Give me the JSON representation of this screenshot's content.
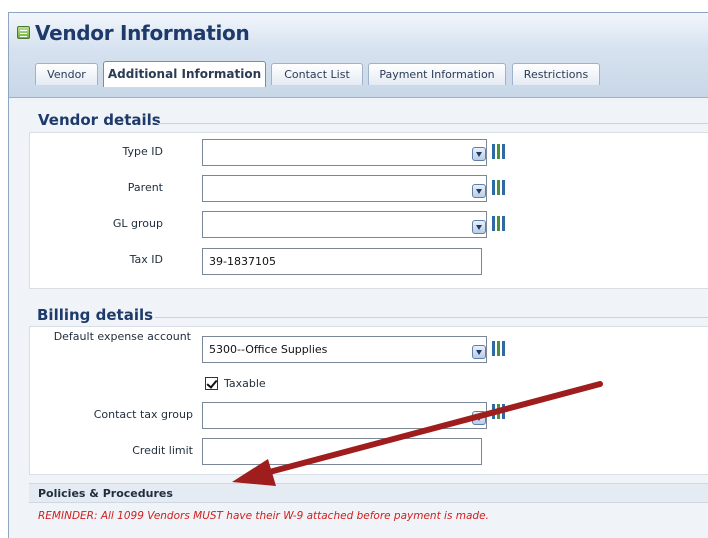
{
  "window": {
    "title": "Vendor Information"
  },
  "tabs": [
    {
      "label": "Vendor"
    },
    {
      "label": "Additional Information"
    },
    {
      "label": "Contact List"
    },
    {
      "label": "Payment Information"
    },
    {
      "label": "Restrictions"
    }
  ],
  "vendor_details": {
    "title": "Vendor details",
    "type_id": {
      "label": "Type ID",
      "value": ""
    },
    "parent": {
      "label": "Parent",
      "value": ""
    },
    "gl_group": {
      "label": "GL group",
      "value": ""
    },
    "tax_id": {
      "label": "Tax ID",
      "value": "39-1837105"
    }
  },
  "billing_details": {
    "title": "Billing details",
    "default_expense_account": {
      "label": "Default expense account",
      "value": "5300--Office Supplies"
    },
    "taxable": {
      "label": "Taxable",
      "checked": true
    },
    "contact_tax_group": {
      "label": "Contact tax group",
      "value": ""
    },
    "credit_limit": {
      "label": "Credit limit",
      "value": ""
    }
  },
  "policies": {
    "title": "Policies & Procedures",
    "reminder": "REMINDER: All 1099 Vendors MUST have their W-9 attached before payment is made."
  },
  "colors": {
    "title": "#1d3a6b",
    "reminder": "#d01e1e",
    "arrow": "#a01d1d",
    "tab_strip": "#c8d7e7"
  },
  "icons": [
    "list-icon",
    "dropdown-icon",
    "lookup-icon",
    "checkbox-checked-icon",
    "annotation-arrow"
  ]
}
